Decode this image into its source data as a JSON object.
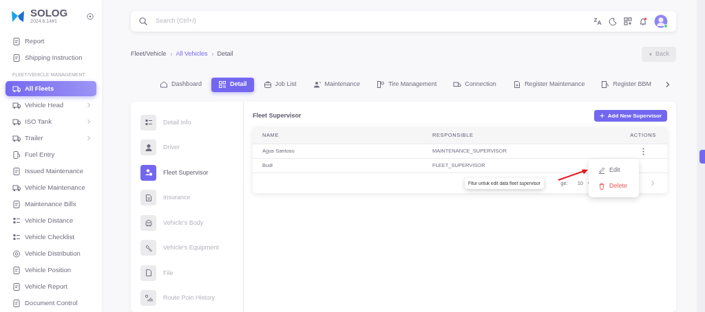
{
  "brand": {
    "name": "SOLOG",
    "version": "2024.6.14#1"
  },
  "sidebar": {
    "items": [
      {
        "label": "Report",
        "selected": false,
        "has_submenu": false
      },
      {
        "label": "Shipping Instruction",
        "selected": false,
        "has_submenu": false
      },
      {
        "kind": "header",
        "label": "FLEET/VEHICLE MANAGEMENT"
      },
      {
        "label": "All Fleets",
        "selected": true,
        "has_submenu": false
      },
      {
        "label": "Vehicle Head",
        "selected": false,
        "has_submenu": true
      },
      {
        "label": "ISO Tank",
        "selected": false,
        "has_submenu": true
      },
      {
        "label": "Trailer",
        "selected": false,
        "has_submenu": true
      },
      {
        "label": "Fuel Entry",
        "selected": false,
        "has_submenu": false
      },
      {
        "label": "Issued Maintenance",
        "selected": false,
        "has_submenu": false
      },
      {
        "label": "Vehicle Maintenance",
        "selected": false,
        "has_submenu": false
      },
      {
        "label": "Maintenance Bills",
        "selected": false,
        "has_submenu": false
      },
      {
        "label": "Vehicle Distance",
        "selected": false,
        "has_submenu": false
      },
      {
        "label": "Vehicle Checklist",
        "selected": false,
        "has_submenu": false
      },
      {
        "label": "Vehicle Distribution",
        "selected": false,
        "has_submenu": false
      },
      {
        "label": "Vehicle Position",
        "selected": false,
        "has_submenu": false
      },
      {
        "label": "Vehicle Report",
        "selected": false,
        "has_submenu": false
      },
      {
        "label": "Document Control",
        "selected": false,
        "has_submenu": false
      }
    ]
  },
  "search": {
    "placeholder": "Search (Ctrl+/)"
  },
  "notifications": {
    "unread": true
  },
  "breadcrumb": [
    {
      "label": "Fleet/Vehicle",
      "link": false
    },
    {
      "label": "All Vehicles",
      "link": true
    },
    {
      "label": "Detail",
      "link": false
    }
  ],
  "back_button": {
    "label": "Back",
    "disabled": true
  },
  "tabs": [
    {
      "label": "Dashboard",
      "selected": false
    },
    {
      "label": "Detail",
      "selected": true
    },
    {
      "label": "Job List",
      "selected": false
    },
    {
      "label": "Maintenance",
      "selected": false
    },
    {
      "label": "Tire Management",
      "selected": false
    },
    {
      "label": "Connection",
      "selected": false
    },
    {
      "label": "Register Maintenance",
      "selected": false
    },
    {
      "label": "Register BBM",
      "selected": false
    }
  ],
  "detail_nav": [
    {
      "label": "Detail Info",
      "selected": false
    },
    {
      "label": "Driver",
      "selected": false
    },
    {
      "label": "Fleet Supervisor",
      "selected": true
    },
    {
      "label": "Insurance",
      "selected": false
    },
    {
      "label": "Vehicle's Body",
      "selected": false
    },
    {
      "label": "Vehicle's Equipment",
      "selected": false
    },
    {
      "label": "File",
      "selected": false
    },
    {
      "label": "Route Poin History",
      "selected": false
    }
  ],
  "section_title": "Fleet Supervisor",
  "add_button": "Add New Supervisor",
  "table": {
    "columns": [
      "NAME",
      "RESPONSIBLE",
      "ACTIONS"
    ],
    "rows": [
      {
        "name": "Agus Santoso",
        "responsible": "MAINTENANCE_SUPERVISOR",
        "show_actions": true
      },
      {
        "name": "Budi",
        "responsible": "FLEET_SUPERVISOR",
        "show_actions": false
      }
    ],
    "footer": {
      "rows_label": "ge:",
      "per_page": "10"
    }
  },
  "action_menu": [
    {
      "label": "Edit",
      "kind": "edit"
    },
    {
      "label": "Delete",
      "kind": "delete"
    }
  ],
  "annotation": {
    "text": "Fitur untuk edit data fleet supervisor"
  }
}
